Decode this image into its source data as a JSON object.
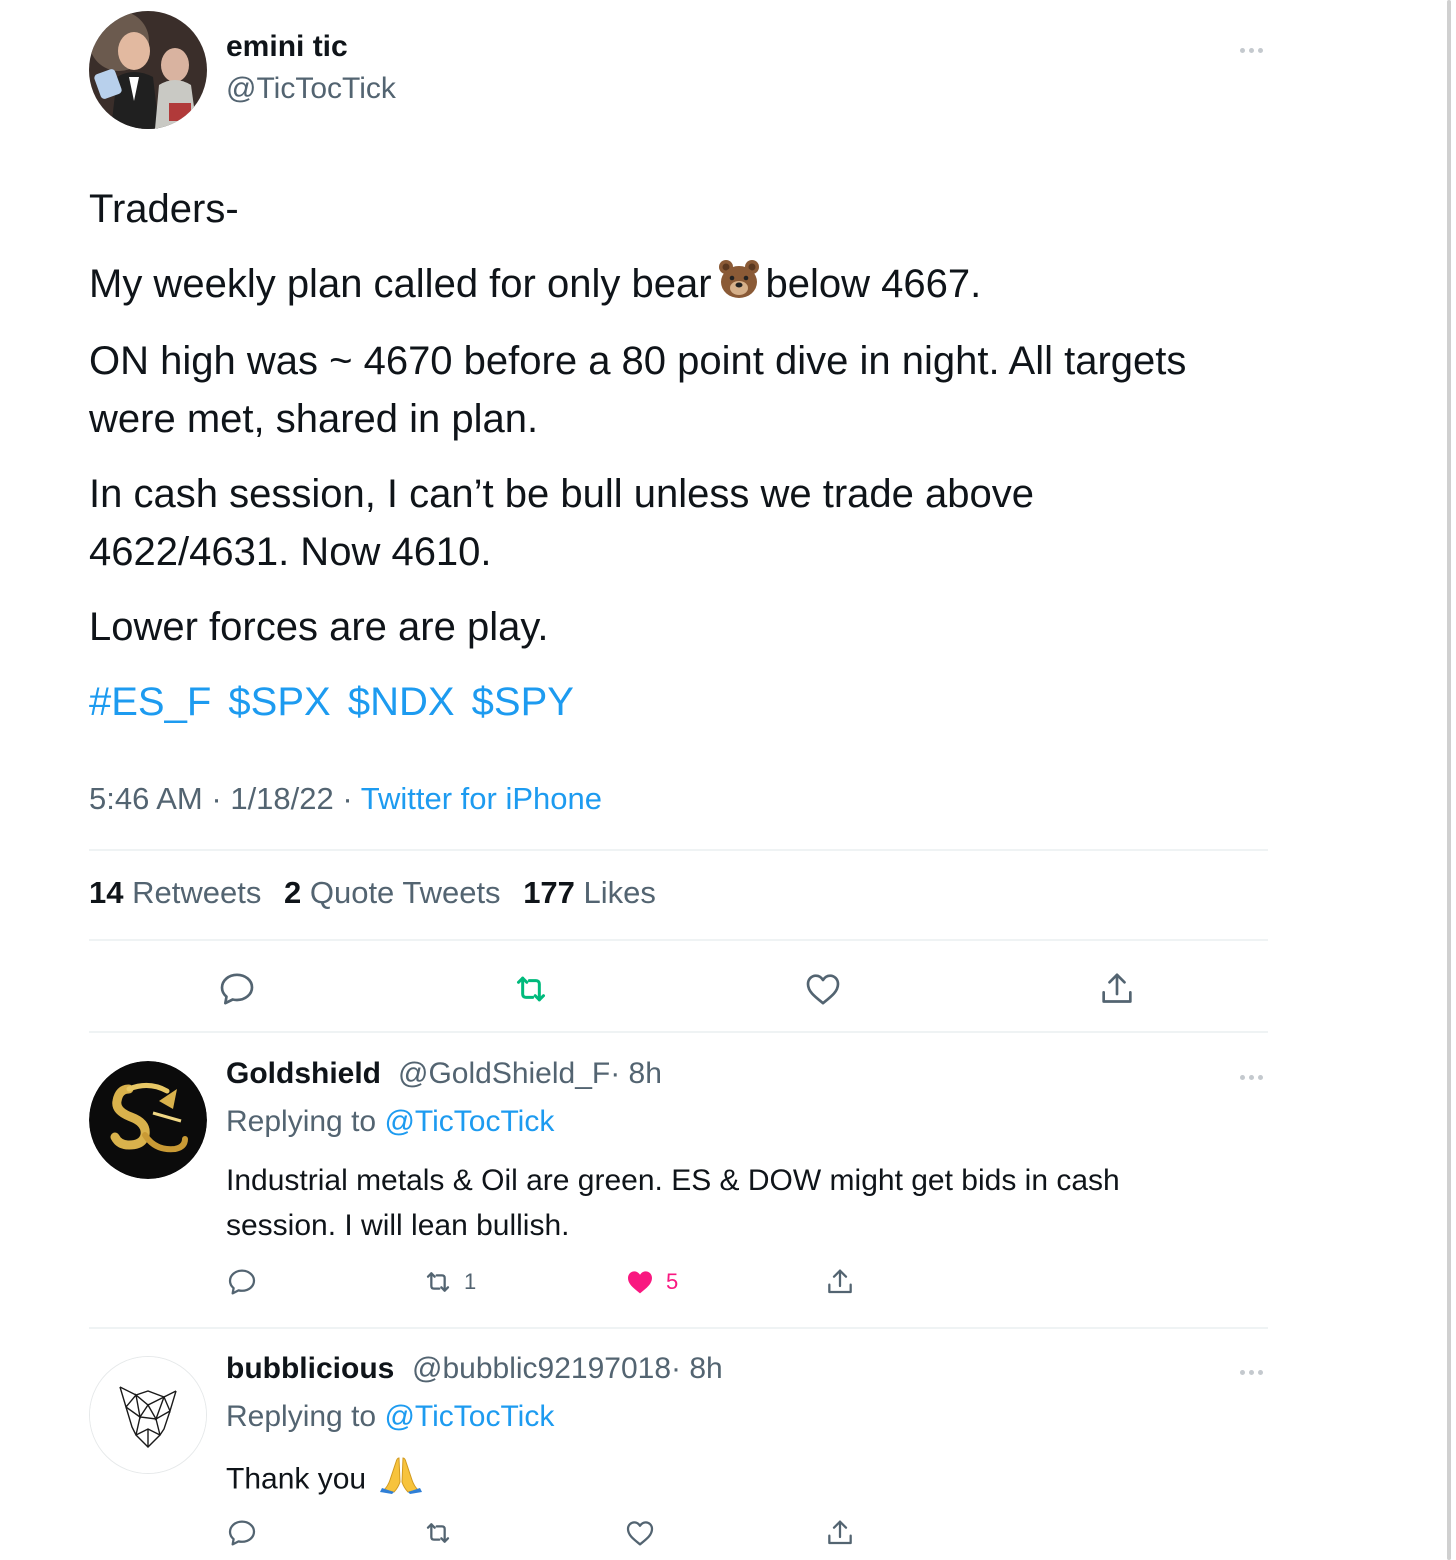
{
  "tweet": {
    "author_name": "emini tic",
    "author_handle": "@TicTocTick",
    "body": [
      "Traders-",
      "My weekly plan called for only bear",
      "below 4667.",
      "ON high was ~ 4670 before a 80 point dive in night. All targets were met, shared in plan.",
      "In cash session, I can’t be bull unless we trade above 4622/4631. Now 4610.",
      "Lower forces are are play."
    ],
    "emoji_icon": "bear-face-icon",
    "hashtags": [
      "#ES_F",
      "$SPX",
      "$NDX",
      "$SPY"
    ],
    "time": "5:46 AM",
    "date": "1/18/22",
    "source": "Twitter for iPhone",
    "separator": "·",
    "stats": {
      "retweets_count": "14",
      "retweets_label": "Retweets",
      "quotes_count": "2",
      "quotes_label": "Quote Tweets",
      "likes_count": "177",
      "likes_label": "Likes"
    },
    "retweet_color": "#00ba7c"
  },
  "replies": [
    {
      "name": "Goldshield",
      "handle": "@GoldShield_F",
      "age": "· 8h",
      "replying_label": "Replying to",
      "replying_to": "@TicTocTick",
      "text": "Industrial metals & Oil are green. ES & DOW might get bids in cash session. I will lean bullish.",
      "retweet_count": "1",
      "like_count": "5",
      "liked": true
    },
    {
      "name": "bubblicious",
      "handle": "@bubblic92197018",
      "age": "· 8h",
      "replying_label": "Replying to",
      "replying_to": "@TicTocTick",
      "text": "Thank you",
      "emoji_icon": "folded-hands-icon",
      "retweet_count": "",
      "like_count": "",
      "liked": false
    }
  ],
  "colors": {
    "link": "#1d9bf0",
    "secondary_text": "#536471",
    "like": "#f91880",
    "retweet": "#00ba7c"
  }
}
